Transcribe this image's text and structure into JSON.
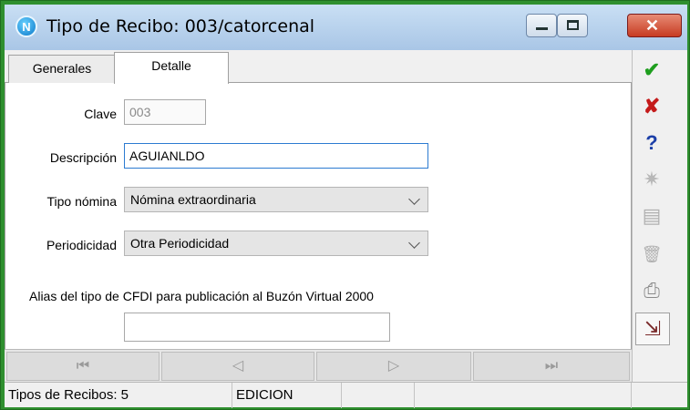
{
  "window": {
    "title": "Tipo de Recibo: 003/catorcenal",
    "app_icon_letter": "N",
    "icons": {
      "app": "app-n-icon",
      "minimize": "minimize-icon",
      "maximize": "maximize-icon",
      "close": "close-icon"
    }
  },
  "tabs": [
    {
      "label": "Generales",
      "selected": false
    },
    {
      "label": "Detalle",
      "selected": true
    }
  ],
  "form": {
    "clave": {
      "label": "Clave",
      "value": "003"
    },
    "descripcion": {
      "label": "Descripción",
      "value": "AGUIANLDO"
    },
    "tipo_nomina": {
      "label": "Tipo nómina",
      "value": "Nómina extraordinaria"
    },
    "periodicidad": {
      "label": "Periodicidad",
      "value": "Otra Periodicidad"
    },
    "alias": {
      "label": "Alias del tipo de CFDI para publicación al Buzón Virtual 2000",
      "value": ""
    }
  },
  "toolbar": {
    "icons": [
      "checkmark-icon",
      "cancel-x-icon",
      "help-question-icon",
      "bug-icon",
      "copy-icon",
      "delete-trash-icon",
      "print-icon",
      "export-icon"
    ],
    "colors": {
      "ok": "#1e9e1e",
      "cancel": "#c41a1a",
      "help": "#1c3fa8"
    },
    "glyphs": {
      "ok": "✔",
      "cancel": "✘",
      "help": "?",
      "bug": "✷",
      "copy": "▤",
      "delete": "🗑",
      "print": "⎙",
      "export": "⇲"
    }
  },
  "navigation": {
    "glyphs": {
      "first": "⏮",
      "prev": "◁",
      "next": "▷",
      "last": "⏭"
    }
  },
  "status": {
    "record_count": "Tipos de Recibos: 5",
    "mode": "EDICION",
    "extra_1": "",
    "extra_2": ""
  }
}
